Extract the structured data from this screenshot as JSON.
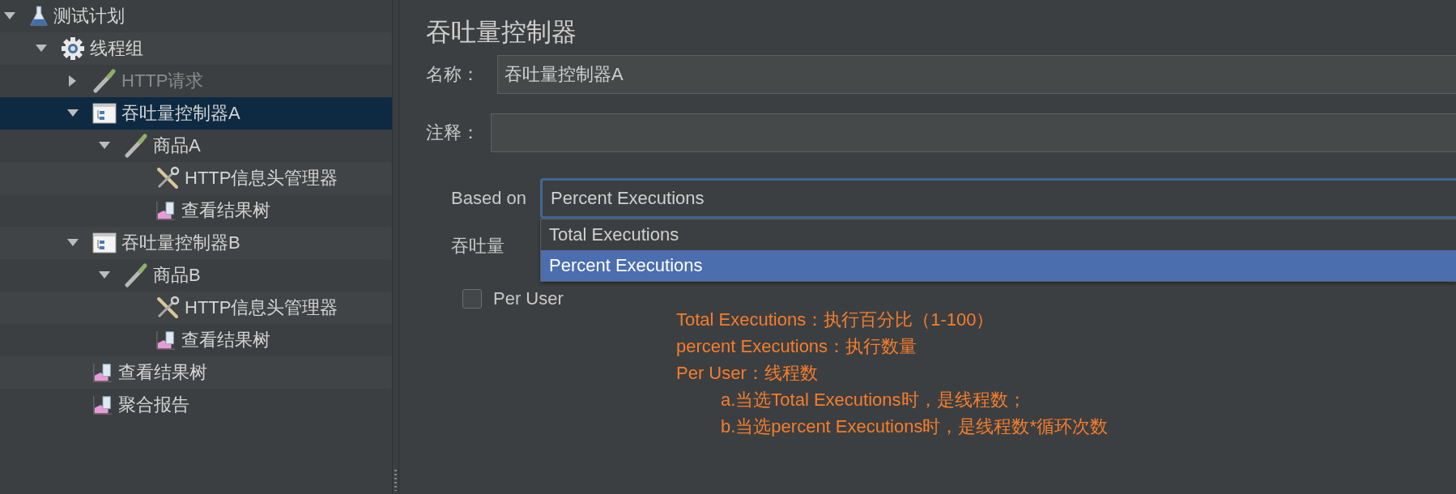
{
  "tree": [
    {
      "label": "测试计划",
      "kind": "test-plan",
      "expanded": true,
      "selected": false,
      "disabled": false,
      "children": [
        {
          "label": "线程组",
          "kind": "thread-group",
          "expanded": true,
          "selected": false,
          "disabled": false,
          "children": [
            {
              "label": "HTTP请求",
              "kind": "sampler",
              "expanded": false,
              "selected": false,
              "disabled": true
            },
            {
              "label": "吞吐量控制器A",
              "kind": "controller",
              "expanded": true,
              "selected": true,
              "disabled": false,
              "children": [
                {
                  "label": "商品A",
                  "kind": "sampler",
                  "expanded": true,
                  "selected": false,
                  "disabled": false,
                  "children": [
                    {
                      "label": "HTTP信息头管理器",
                      "kind": "config",
                      "selected": false,
                      "disabled": false
                    },
                    {
                      "label": "查看结果树",
                      "kind": "listener",
                      "selected": false,
                      "disabled": false
                    }
                  ]
                }
              ]
            },
            {
              "label": "吞吐量控制器B",
              "kind": "controller",
              "expanded": true,
              "selected": false,
              "disabled": false,
              "children": [
                {
                  "label": "商品B",
                  "kind": "sampler",
                  "expanded": true,
                  "selected": false,
                  "disabled": false,
                  "children": [
                    {
                      "label": "HTTP信息头管理器",
                      "kind": "config",
                      "selected": false,
                      "disabled": false
                    },
                    {
                      "label": "查看结果树",
                      "kind": "listener",
                      "selected": false,
                      "disabled": false
                    }
                  ]
                }
              ]
            },
            {
              "label": "查看结果树",
              "kind": "listener",
              "selected": false,
              "disabled": false
            },
            {
              "label": "聚合报告",
              "kind": "listener",
              "selected": false,
              "disabled": false
            }
          ]
        }
      ]
    }
  ],
  "panel": {
    "title": "吞吐量控制器",
    "name_field": {
      "label": "名称：",
      "value": "吞吐量控制器A"
    },
    "comment_field": {
      "label": "注释："
    },
    "based_on": {
      "label": "Based on",
      "value": "Percent Executions",
      "options": [
        {
          "label": "Total Executions",
          "selected": false
        },
        {
          "label": "Percent Executions",
          "selected": true
        }
      ]
    },
    "throughput": {
      "label": "吞吐量"
    },
    "per_user": {
      "label": "Per User",
      "checked": false
    },
    "annotation": [
      {
        "text": "Total Executions：执行百分比（1-100）",
        "kind": "line"
      },
      {
        "text": "percent Executions：执行数量",
        "kind": "line"
      },
      {
        "text": "Per User：线程数",
        "kind": "line"
      },
      {
        "text": "a.当选Total Executions时，是线程数；",
        "kind": "subline"
      },
      {
        "text": "b.当选percent Executions时，是线程数*循环次数",
        "kind": "subline"
      }
    ]
  }
}
